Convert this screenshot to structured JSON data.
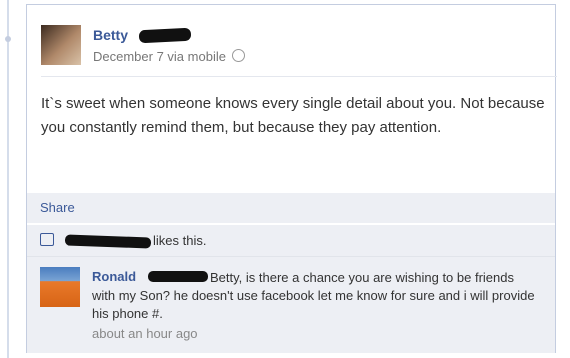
{
  "post": {
    "author": "Betty",
    "date": "December 7 via mobile",
    "text": "It`s sweet when someone knows every single detail about you. Not because you constantly remind them, but because they pay attention."
  },
  "actions": {
    "share_label": "Share"
  },
  "likes": {
    "suffix": "likes this."
  },
  "comment": {
    "author": "Ronald",
    "text": "Betty, is there a chance you are wishing to be friends with my Son? he doesn't use facebook let me know for sure and i will provide his phone #.",
    "time": "about an hour ago"
  },
  "icons": [
    "globe-icon",
    "like-icon"
  ]
}
